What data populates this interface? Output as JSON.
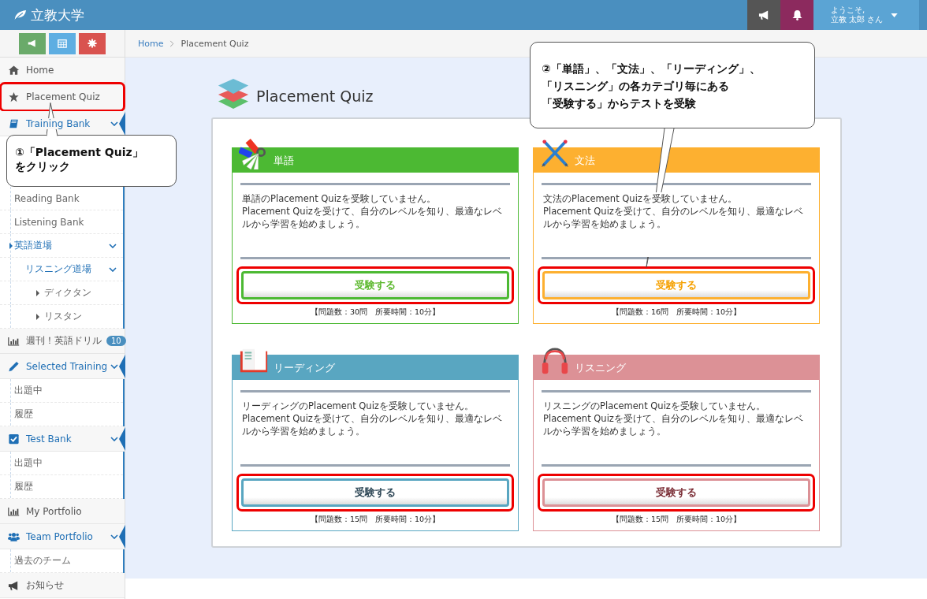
{
  "header": {
    "logo": "立教大学",
    "user": {
      "greeting": "ようこそ,",
      "name": "立教 太郎 さん"
    }
  },
  "sidebar": {
    "items": [
      {
        "label": "Home",
        "kind": "home",
        "expanded": false
      },
      {
        "label": "Placement Quiz",
        "kind": "star",
        "expanded": false,
        "highlighted": true
      },
      {
        "label": "Training Bank",
        "kind": "book",
        "expanded": true,
        "children": [
          {
            "label": "Reading Bank",
            "expanded": false
          },
          {
            "label": "Listening Bank",
            "expanded": false
          },
          {
            "label": "英語道場",
            "expanded": true,
            "children": [
              {
                "label": "リスニング道場",
                "expanded": true,
                "children": [
                  {
                    "label": "ディクタン",
                    "expanded": false
                  },
                  {
                    "label": "リスタン",
                    "expanded": false
                  }
                ]
              }
            ]
          }
        ]
      },
      {
        "label": "週刊！英語ドリル",
        "kind": "chart",
        "expanded": false,
        "badge": "10"
      },
      {
        "label": "Selected Training",
        "kind": "pencil",
        "expanded": true,
        "children": [
          {
            "label": "出題中",
            "expanded": false
          },
          {
            "label": "履歴",
            "expanded": false
          }
        ]
      },
      {
        "label": "Test Bank",
        "kind": "check",
        "expanded": true,
        "children": [
          {
            "label": "出題中",
            "expanded": false
          },
          {
            "label": "履歴",
            "expanded": false
          }
        ]
      },
      {
        "label": "My Portfolio",
        "kind": "chart",
        "expanded": false
      },
      {
        "label": "Team Portfolio",
        "kind": "people",
        "expanded": true,
        "children": [
          {
            "label": "過去のチーム",
            "expanded": false
          }
        ]
      },
      {
        "label": "お知らせ",
        "kind": "megaphone",
        "expanded": false
      }
    ]
  },
  "breadcrumb": [
    "Home",
    "Placement Quiz"
  ],
  "page_title": "Placement Quiz",
  "cards": [
    {
      "kind": "vocabulary",
      "title": "単語",
      "color": "#4cb933",
      "description": "単語のPlacement Quizを受験していません。\nPlacement Quizを受けて、自分のレベルを知り、最適なレベルから学習を始めましょう。",
      "button": {
        "label": "受験する",
        "highlighted": true
      },
      "info": "【問題数：30問　所要時間：10分】"
    },
    {
      "kind": "grammar",
      "title": "文法",
      "color": "#fdb030",
      "description": "文法のPlacement Quizを受験していません。\nPlacement Quizを受けて、自分のレベルを知り、最適なレベルから学習を始めましょう。",
      "button": {
        "label": "受験する",
        "highlighted": true
      },
      "info": "【問題数：16問　所要時間：10分】"
    },
    {
      "kind": "reading",
      "title": "リーディング",
      "color": "#59a6c1",
      "description": "リーディングのPlacement Quizを受験していません。\nPlacement Quizを受けて、自分のレベルを知り、最適なレベルから学習を始めましょう。",
      "button": {
        "label": "受験する",
        "highlighted": true
      },
      "info": "【問題数：15問　所要時間：10分】"
    },
    {
      "kind": "listening",
      "title": "リスニング",
      "color": "#dc9196",
      "description": "リスニングのPlacement Quizを受験していません。\nPlacement Quizを受けて、自分のレベルを知り、最適なレベルから学習を始めましょう。",
      "button": {
        "label": "受験する",
        "highlighted": true
      },
      "info": "【問題数：15問　所要時間：10分】"
    }
  ],
  "callouts": [
    {
      "lines": [
        "①「Placement Quiz」",
        "をクリック"
      ]
    },
    {
      "lines": [
        "②「単語」、「文法」、「リーディング」、",
        "「リスニング」の各カテゴリ毎にある",
        "「受験する」からテストを受験"
      ]
    }
  ]
}
